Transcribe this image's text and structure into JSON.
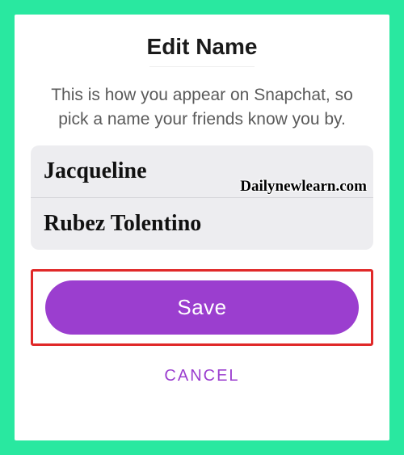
{
  "header": {
    "title": "Edit Name"
  },
  "description": "This is how you appear on Snapchat, so pick a name your friends know you by.",
  "watermark": "Dailynewlearn.com",
  "form": {
    "first_name_value": "Jacqueline",
    "last_name_value": "Rubez Tolentino"
  },
  "actions": {
    "save_label": "Save",
    "cancel_label": "CANCEL"
  }
}
